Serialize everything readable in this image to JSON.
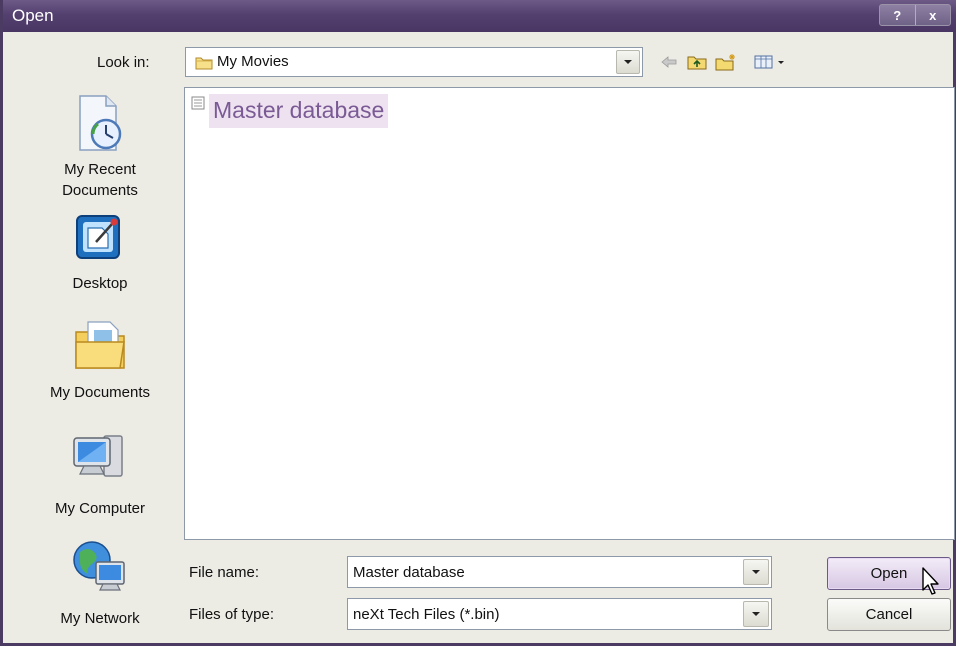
{
  "window": {
    "title": "Open",
    "help_label": "?",
    "close_label": "x"
  },
  "look_in": {
    "label": "Look in:",
    "value": "My Movies"
  },
  "places": [
    {
      "label_line1": "My Recent",
      "label_line2": "Documents"
    },
    {
      "label_line1": "Desktop",
      "label_line2": ""
    },
    {
      "label_line1": "My Documents",
      "label_line2": ""
    },
    {
      "label_line1": "My Computer",
      "label_line2": ""
    },
    {
      "label_line1": "My Network",
      "label_line2": ""
    }
  ],
  "files": [
    {
      "name": "Master database",
      "selected": true
    }
  ],
  "file_name": {
    "label": "File name:",
    "value": "Master database"
  },
  "file_type": {
    "label": "Files of type:",
    "value": "neXt Tech Files (*.bin)"
  },
  "buttons": {
    "open": "Open",
    "cancel": "Cancel"
  },
  "colors": {
    "titlebar": "#54406f",
    "dialog_bg": "#ecebe4",
    "selection": "#eee2f0",
    "selection_text": "#7a5a95"
  },
  "icons": [
    "folder-icon",
    "back-arrow-icon",
    "up-folder-icon",
    "new-folder-icon",
    "view-menu-icon",
    "recent-documents-icon",
    "desktop-icon",
    "my-documents-icon",
    "my-computer-icon",
    "my-network-icon",
    "database-file-icon",
    "cursor-icon"
  ]
}
